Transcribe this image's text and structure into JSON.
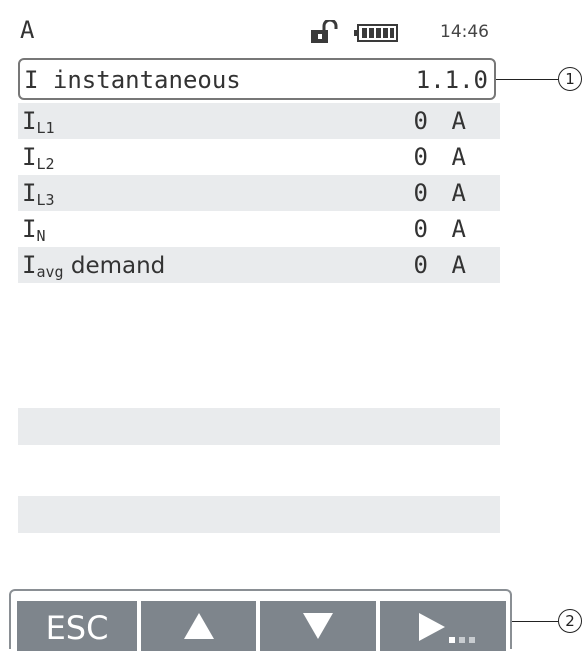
{
  "status": {
    "unit": "A",
    "time": "14:46",
    "lock_state": "unlocked",
    "battery_icon": "battery-full-icon"
  },
  "header": {
    "title": "I instantaneous",
    "id": "1.1.0"
  },
  "rows": [
    {
      "main": "I",
      "sub": "L1",
      "value": "0",
      "unit": "A"
    },
    {
      "main": "I",
      "sub": "L2",
      "value": "0",
      "unit": "A"
    },
    {
      "main": "I",
      "sub": "L3",
      "value": "0",
      "unit": "A"
    },
    {
      "main": "I",
      "sub": "N",
      "value": "0",
      "unit": "A"
    },
    {
      "main": "I",
      "sub": "avg",
      "suffix": " demand",
      "value": "0",
      "unit": "A"
    }
  ],
  "softkeys": [
    {
      "label": "ESC",
      "icon": null
    },
    {
      "label": "",
      "icon": "arrow-up-icon"
    },
    {
      "label": "",
      "icon": "arrow-down-icon"
    },
    {
      "label": "",
      "icon": "arrow-right-more-icon"
    }
  ],
  "callouts": [
    "1",
    "2"
  ],
  "colors": {
    "row_shade": "#e9ebed",
    "softkey_bg": "#7e858c",
    "text": "#333333"
  }
}
